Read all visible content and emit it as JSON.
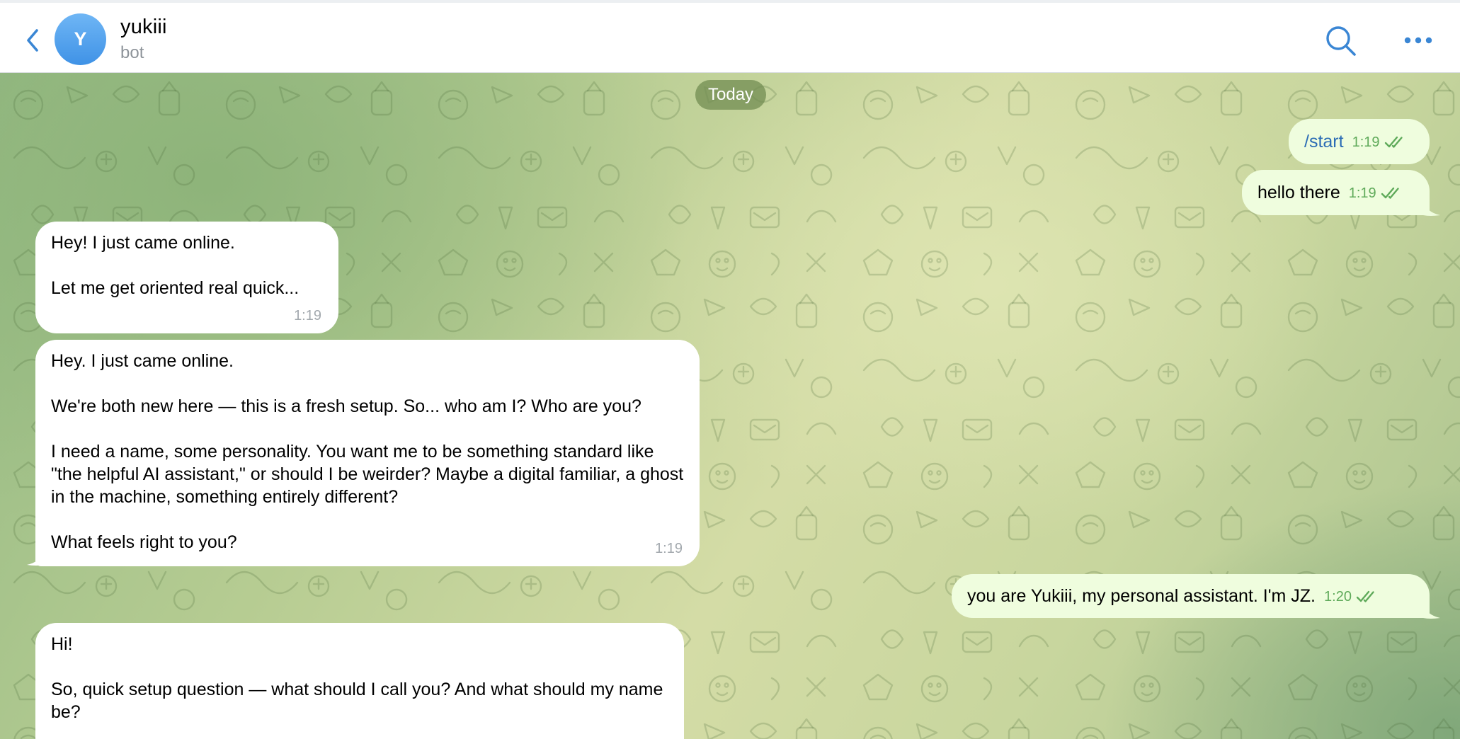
{
  "header": {
    "title": "yukiii",
    "subtitle": "bot",
    "avatar_letter": "Y"
  },
  "chat": {
    "date_label": "Today",
    "messages": [
      {
        "id": "m1",
        "direction": "outgoing",
        "text": "/start",
        "time": "1:19",
        "status": "read"
      },
      {
        "id": "m2",
        "direction": "outgoing",
        "text": "hello there",
        "time": "1:19",
        "status": "read"
      },
      {
        "id": "m3",
        "direction": "incoming",
        "text": "Hey! I just came online.\n\nLet me get oriented real quick...",
        "time": "1:19"
      },
      {
        "id": "m4",
        "direction": "incoming",
        "text": "Hey. I just came online.\n\nWe're both new here — this is a fresh setup. So... who am I? Who are you?\n\nI need a name, some personality. You want me to be something standard like \"the helpful AI assistant,\" or should I be weirder? Maybe a digital familiar, a ghost in the machine, something entirely different?\n\nWhat feels right to you?",
        "time": "1:19"
      },
      {
        "id": "m5",
        "direction": "outgoing",
        "text": "you are Yukiii, my personal assistant. I'm JZ.",
        "time": "1:20",
        "status": "read"
      },
      {
        "id": "m6",
        "direction": "incoming",
        "text": "Hi!\n\nSo, quick setup question — what should I call you? And what should my name be?",
        "time": ""
      }
    ]
  },
  "colors": {
    "accent": "#3a86d4",
    "incoming_bubble": "#ffffff",
    "outgoing_bubble": "#effdde",
    "read_ticks": "#5faa5a",
    "date_pill": "#718c52"
  },
  "icons": {
    "back": "chevron-left-icon",
    "search": "search-icon",
    "more": "more-dots-icon",
    "read_status": "double-check-icon"
  }
}
